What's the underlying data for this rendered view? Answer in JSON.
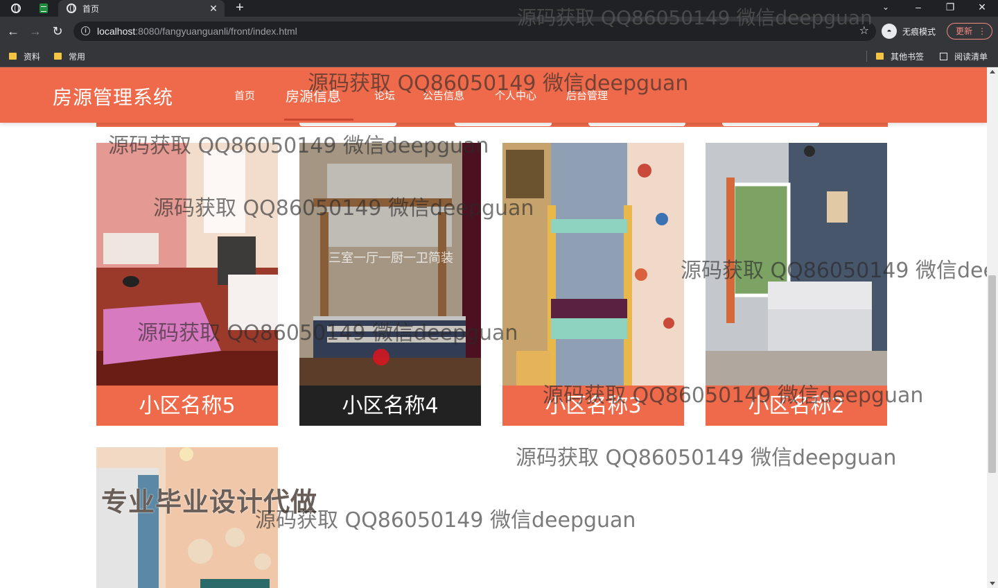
{
  "browser": {
    "tab_title": "首页",
    "url_host": "localhost",
    "url_path": ":8080/fangyuanguanli/front/index.html",
    "profile_label": "无痕模式",
    "update_label": "更新",
    "bookmarks": [
      "资料",
      "常用"
    ],
    "other_bookmarks": "其他书签",
    "reading_list": "阅读清单"
  },
  "site": {
    "brand": "房源管理系统",
    "nav": [
      "首页",
      "房源信息",
      "论坛",
      "公告信息",
      "个人中心",
      "后台管理"
    ],
    "active_nav": "房源信息"
  },
  "listings": [
    {
      "name": "小区名称5"
    },
    {
      "name": "小区名称4",
      "overlay": "三室一厅一厨一卫简装",
      "hovered": true
    },
    {
      "name": "小区名称3"
    },
    {
      "name": "小区名称2"
    }
  ],
  "promo_text": "专业毕业设计代做",
  "watermark": "源码获取 QQ86050149 微信deepguan",
  "colors": {
    "accent": "#ee6a4a",
    "hover_caption": "#222222",
    "browser_dark": "#35363a"
  }
}
